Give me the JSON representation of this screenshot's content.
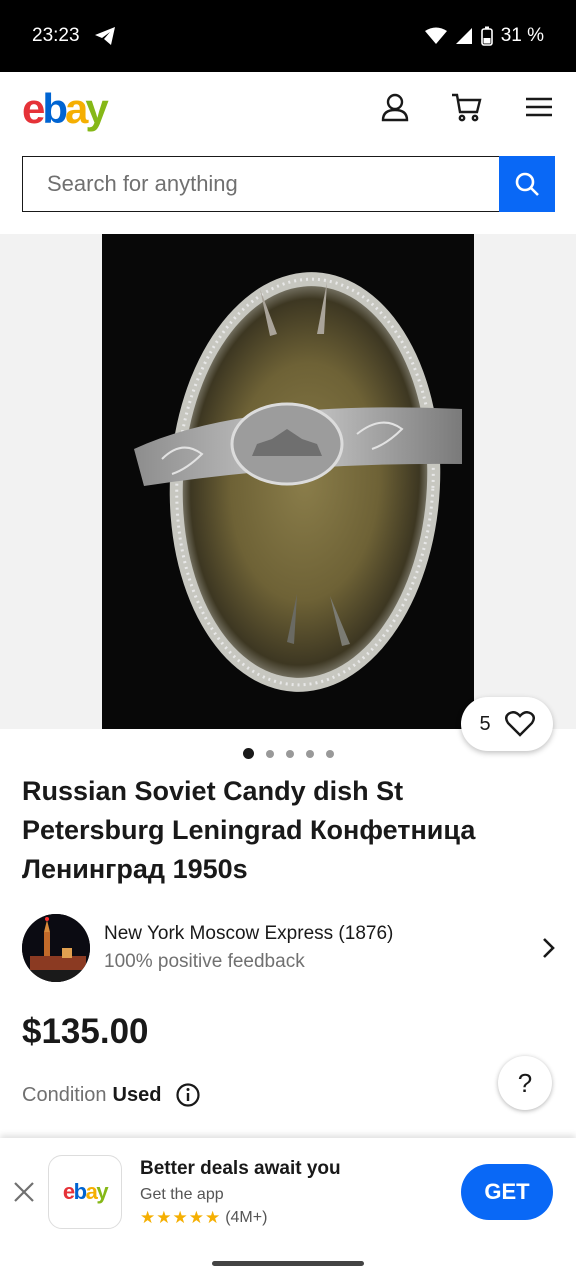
{
  "status_bar": {
    "time": "23:23",
    "battery": "31 %",
    "icons": [
      "telegram-icon",
      "wifi-icon",
      "signal-icon",
      "battery-icon"
    ]
  },
  "header": {
    "logo_letters": [
      "e",
      "b",
      "a",
      "y"
    ],
    "icons": [
      "account-icon",
      "cart-icon",
      "menu-icon"
    ]
  },
  "search": {
    "placeholder": "Search for anything"
  },
  "gallery": {
    "watch_count": "5",
    "image_count": 5,
    "active_index": 0
  },
  "listing": {
    "title": "Russian Soviet Candy dish St Petersburg Leningrad Конфетница Ленинград 1950s",
    "seller_name": "New York Moscow Express (1876)",
    "seller_feedback": "100% positive feedback",
    "price": "$135.00",
    "condition_label": "Condition",
    "condition_value": "Used"
  },
  "help": {
    "label": "?"
  },
  "app_banner": {
    "title": "Better deals await you",
    "subtitle": "Get the app",
    "rating_count": "(4M+)",
    "cta": "GET"
  },
  "colors": {
    "accent_blue": "#0968f6",
    "logo_red": "#e53238",
    "logo_blue": "#0064d2",
    "logo_yellow": "#f5af02",
    "logo_green": "#86b817"
  }
}
